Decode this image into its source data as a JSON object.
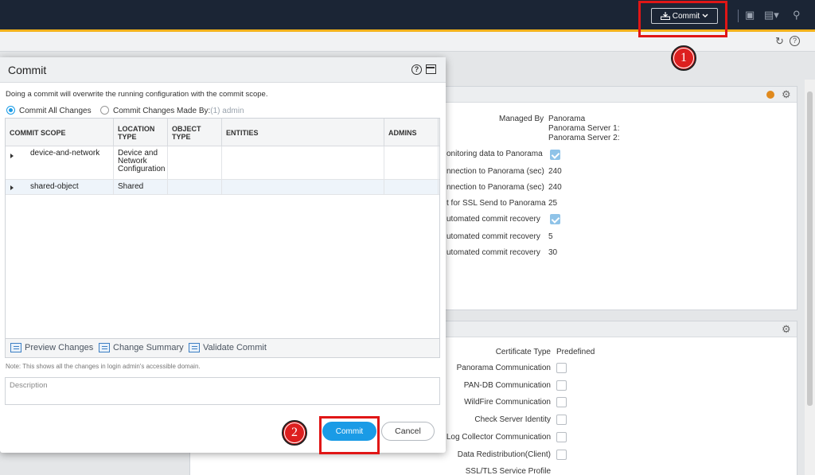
{
  "topbar": {
    "commit_label": "Commit",
    "colors": {
      "bar": "#1b2535",
      "accent": "#f2b21b"
    },
    "icons": [
      "commit-icon",
      "chevron-down-icon",
      "lock-icon",
      "config-icon",
      "search-icon"
    ]
  },
  "subbar": {
    "icons": [
      "refresh-icon",
      "help-icon"
    ]
  },
  "background": {
    "panel1": {
      "managed_by_label": "Managed By",
      "managed_by_value": "Panorama",
      "server1_label": "Panorama Server 1:",
      "server2_label": "Panorama Server 2:",
      "rows": [
        {
          "label": "onitoring data to Panorama",
          "value": "",
          "checked": true
        },
        {
          "label": "nnection to Panorama (sec)",
          "value": "240"
        },
        {
          "label": "nnection to Panorama (sec)",
          "value": "240"
        },
        {
          "label": "t for SSL Send to Panorama",
          "value": "25"
        },
        {
          "label": "utomated commit recovery",
          "value": "",
          "checked": true
        },
        {
          "label": "utomated commit recovery",
          "value": "5"
        },
        {
          "label": "utomated commit recovery",
          "value": "30"
        }
      ]
    },
    "panel2": {
      "certificate_type_label": "Certificate Type",
      "certificate_type_value": "Predefined",
      "rows": [
        {
          "label": "Panorama Communication"
        },
        {
          "label": "PAN-DB Communication"
        },
        {
          "label": "WildFire Communication"
        },
        {
          "label": "Check Server Identity"
        },
        {
          "label": "Log Collector Communication"
        },
        {
          "label": "Data Redistribution(Client)"
        },
        {
          "label": "SSL/TLS Service Profile"
        }
      ]
    }
  },
  "modal": {
    "title": "Commit",
    "description": "Doing a commit will overwrite the running configuration with the commit scope.",
    "radio_all": "Commit All Changes",
    "radio_by": "Commit Changes Made By:",
    "radio_by_suffix": "(1) admin",
    "columns": [
      "COMMIT SCOPE",
      "LOCATION TYPE",
      "OBJECT TYPE",
      "ENTITIES",
      "ADMINS"
    ],
    "rows": [
      {
        "scope": "device-and-network",
        "location": "Device and Network Configuration",
        "object": "",
        "entities": "",
        "admins": ""
      },
      {
        "scope": "shared-object",
        "location": "Shared",
        "object": "",
        "entities": "",
        "admins": ""
      }
    ],
    "footer_links": [
      "Preview Changes",
      "Change Summary",
      "Validate Commit"
    ],
    "note": "Note: This shows all the changes in login admin's accessible domain.",
    "description_placeholder": "Description",
    "commit_button": "Commit",
    "cancel_button": "Cancel",
    "accent_color": "#1a9be6"
  },
  "annotations": {
    "marker1": "1",
    "marker2": "2",
    "highlight_color": "#e01616"
  }
}
